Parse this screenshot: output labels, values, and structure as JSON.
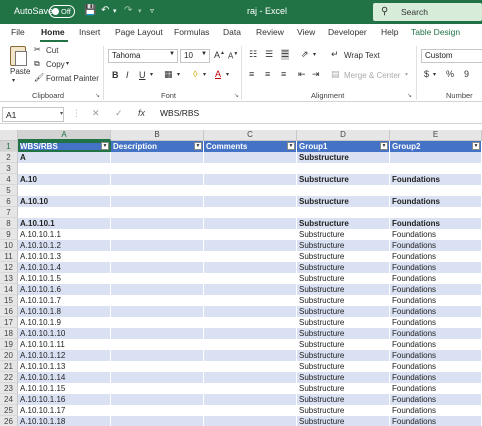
{
  "titlebar": {
    "autosave_label": "AutoSave",
    "toggle_state": "Off",
    "doc_title": "raj - Excel",
    "search_placeholder": "Search"
  },
  "tabs": [
    "File",
    "Home",
    "Insert",
    "Page Layout",
    "Formulas",
    "Data",
    "Review",
    "View",
    "Developer",
    "Help",
    "Table Design"
  ],
  "active_tab": "Home",
  "ribbon": {
    "clipboard": {
      "paste": "Paste",
      "cut": "Cut",
      "copy": "Copy",
      "format_painter": "Format Painter",
      "label": "Clipboard"
    },
    "font": {
      "name": "Tahoma",
      "size": "10",
      "bold": "B",
      "italic": "I",
      "underline": "U",
      "grow": "A",
      "shrink": "A",
      "label": "Font"
    },
    "alignment": {
      "wrap_text": "Wrap Text",
      "merge_center": "Merge & Center",
      "label": "Alignment"
    },
    "number": {
      "format": "Custom",
      "currency": "$",
      "percent": "%",
      "comma": "9",
      "label": "Number"
    }
  },
  "formula_bar": {
    "name_box": "A1",
    "fx": "fx",
    "value": "WBS/RBS"
  },
  "columns": [
    "A",
    "B",
    "C",
    "D",
    "E"
  ],
  "header_row": [
    "WBS/RBS",
    "Description",
    "Comments",
    "Group1",
    "Group2"
  ],
  "rows": [
    {
      "n": "2",
      "a": "A",
      "d": "Substructure",
      "e": "",
      "bold": true
    },
    {
      "n": "3",
      "a": "",
      "d": "",
      "e": "",
      "bold": false
    },
    {
      "n": "4",
      "a": "A.10",
      "d": "Substructure",
      "e": "Foundations",
      "bold": true
    },
    {
      "n": "5",
      "a": "",
      "d": "",
      "e": "",
      "bold": false
    },
    {
      "n": "6",
      "a": "A.10.10",
      "d": "Substructure",
      "e": "Foundations",
      "bold": true
    },
    {
      "n": "7",
      "a": "",
      "d": "",
      "e": "",
      "bold": false
    },
    {
      "n": "8",
      "a": "A.10.10.1",
      "d": "Substructure",
      "e": "Foundations",
      "bold": true
    },
    {
      "n": "9",
      "a": "A.10.10.1.1",
      "d": "Substructure",
      "e": "Foundations",
      "bold": false
    },
    {
      "n": "10",
      "a": "A.10.10.1.2",
      "d": "Substructure",
      "e": "Foundations",
      "bold": false
    },
    {
      "n": "11",
      "a": "A.10.10.1.3",
      "d": "Substructure",
      "e": "Foundations",
      "bold": false
    },
    {
      "n": "12",
      "a": "A.10.10.1.4",
      "d": "Substructure",
      "e": "Foundations",
      "bold": false
    },
    {
      "n": "13",
      "a": "A.10.10.1.5",
      "d": "Substructure",
      "e": "Foundations",
      "bold": false
    },
    {
      "n": "14",
      "a": "A.10.10.1.6",
      "d": "Substructure",
      "e": "Foundations",
      "bold": false
    },
    {
      "n": "15",
      "a": "A.10.10.1.7",
      "d": "Substructure",
      "e": "Foundations",
      "bold": false
    },
    {
      "n": "16",
      "a": "A.10.10.1.8",
      "d": "Substructure",
      "e": "Foundations",
      "bold": false
    },
    {
      "n": "17",
      "a": "A.10.10.1.9",
      "d": "Substructure",
      "e": "Foundations",
      "bold": false
    },
    {
      "n": "18",
      "a": "A.10.10.1.10",
      "d": "Substructure",
      "e": "Foundations",
      "bold": false
    },
    {
      "n": "19",
      "a": "A.10.10.1.11",
      "d": "Substructure",
      "e": "Foundations",
      "bold": false
    },
    {
      "n": "20",
      "a": "A.10.10.1.12",
      "d": "Substructure",
      "e": "Foundations",
      "bold": false
    },
    {
      "n": "21",
      "a": "A.10.10.1.13",
      "d": "Substructure",
      "e": "Foundations",
      "bold": false
    },
    {
      "n": "22",
      "a": "A.10.10.1.14",
      "d": "Substructure",
      "e": "Foundations",
      "bold": false
    },
    {
      "n": "23",
      "a": "A.10.10.1.15",
      "d": "Substructure",
      "e": "Foundations",
      "bold": false
    },
    {
      "n": "24",
      "a": "A.10.10.1.16",
      "d": "Substructure",
      "e": "Foundations",
      "bold": false
    },
    {
      "n": "25",
      "a": "A.10.10.1.17",
      "d": "Substructure",
      "e": "Foundations",
      "bold": false
    },
    {
      "n": "26",
      "a": "A.10.10.1.18",
      "d": "Substructure",
      "e": "Foundations",
      "bold": false
    }
  ],
  "colors": {
    "brand": "#217346",
    "table_header": "#4472c4",
    "band": "#d9e1f2"
  }
}
